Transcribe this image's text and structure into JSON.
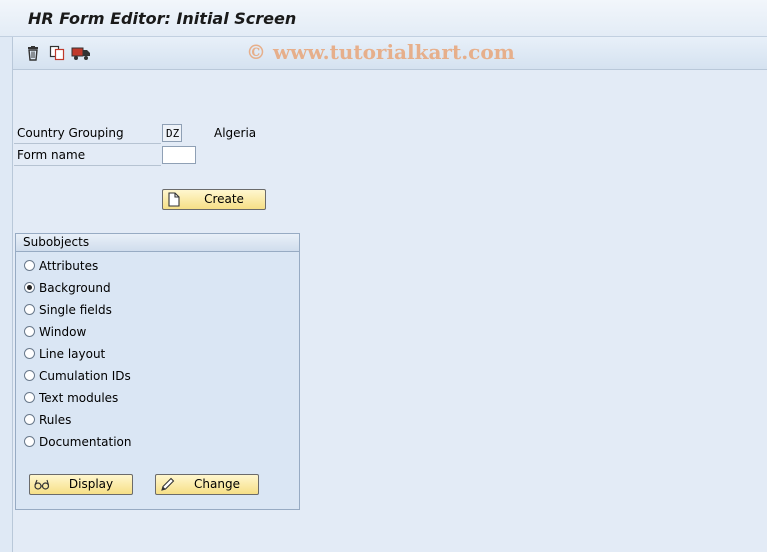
{
  "window": {
    "title": "HR Form Editor: Initial Screen"
  },
  "toolbar": {
    "icons": [
      "trash-icon",
      "copy-icon",
      "transport-truck-icon"
    ],
    "watermark": "© www.tutorialkart.com"
  },
  "fields": {
    "country_grouping": {
      "label": "Country Grouping",
      "value": "DZ",
      "description": "Algeria"
    },
    "form_name": {
      "label": "Form name",
      "value": ""
    }
  },
  "buttons": {
    "create": "Create",
    "display": "Display",
    "change": "Change"
  },
  "subobjects": {
    "title": "Subobjects",
    "selected": "Background",
    "options": [
      {
        "label": "Attributes",
        "checked": false
      },
      {
        "label": "Background",
        "checked": true
      },
      {
        "label": "Single fields",
        "checked": false
      },
      {
        "label": "Window",
        "checked": false
      },
      {
        "label": "Line layout",
        "checked": false
      },
      {
        "label": "Cumulation IDs",
        "checked": false
      },
      {
        "label": "Text modules",
        "checked": false
      },
      {
        "label": "Rules",
        "checked": false
      },
      {
        "label": "Documentation",
        "checked": false
      }
    ]
  }
}
